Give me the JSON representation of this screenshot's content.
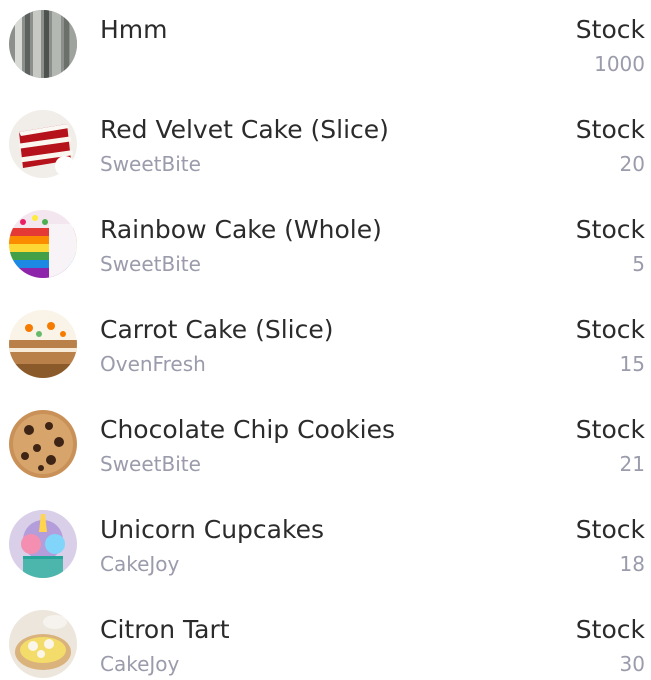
{
  "products": [
    {
      "name": "Hmm",
      "vendor": "",
      "stock_label": "Stock",
      "stock": "1000",
      "image": "curtain-photo"
    },
    {
      "name": "Red Velvet Cake (Slice)",
      "vendor": "SweetBite",
      "stock_label": "Stock",
      "stock": "20",
      "image": "red-velvet-cake-photo"
    },
    {
      "name": "Rainbow Cake (Whole)",
      "vendor": "SweetBite",
      "stock_label": "Stock",
      "stock": "5",
      "image": "rainbow-cake-photo"
    },
    {
      "name": "Carrot Cake (Slice)",
      "vendor": "OvenFresh",
      "stock_label": "Stock",
      "stock": "15",
      "image": "carrot-cake-photo"
    },
    {
      "name": "Chocolate Chip Cookies",
      "vendor": "SweetBite",
      "stock_label": "Stock",
      "stock": "21",
      "image": "chocolate-chip-cookie-photo"
    },
    {
      "name": "Unicorn Cupcakes",
      "vendor": "CakeJoy",
      "stock_label": "Stock",
      "stock": "18",
      "image": "unicorn-cupcake-photo"
    },
    {
      "name": "Citron Tart",
      "vendor": "CakeJoy",
      "stock_label": "Stock",
      "stock": "30",
      "image": "citron-tart-photo"
    }
  ]
}
